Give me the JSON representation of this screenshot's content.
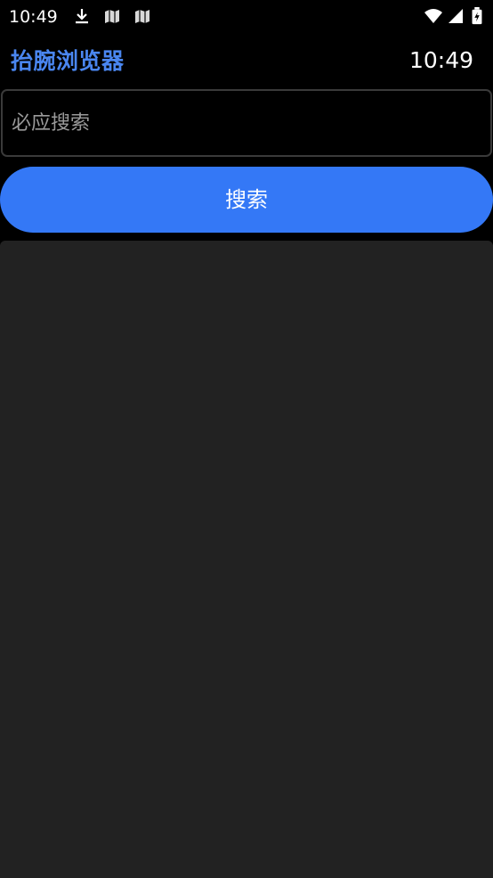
{
  "status_bar": {
    "time": "10:49",
    "left_icons": [
      "download-icon",
      "map-icon",
      "map-icon"
    ],
    "right_icons": [
      "wifi-icon",
      "signal-icon",
      "battery-icon"
    ]
  },
  "header": {
    "title": "抬腕浏览器",
    "clock": "10:49"
  },
  "search": {
    "placeholder": "必应搜索",
    "value": "",
    "button_label": "搜索"
  },
  "colors": {
    "background": "#000000",
    "accent": "#4a86f0",
    "button": "#3478f6",
    "panel": "#222222",
    "input_border": "#3a3a3a",
    "placeholder": "#9a9a9a"
  }
}
